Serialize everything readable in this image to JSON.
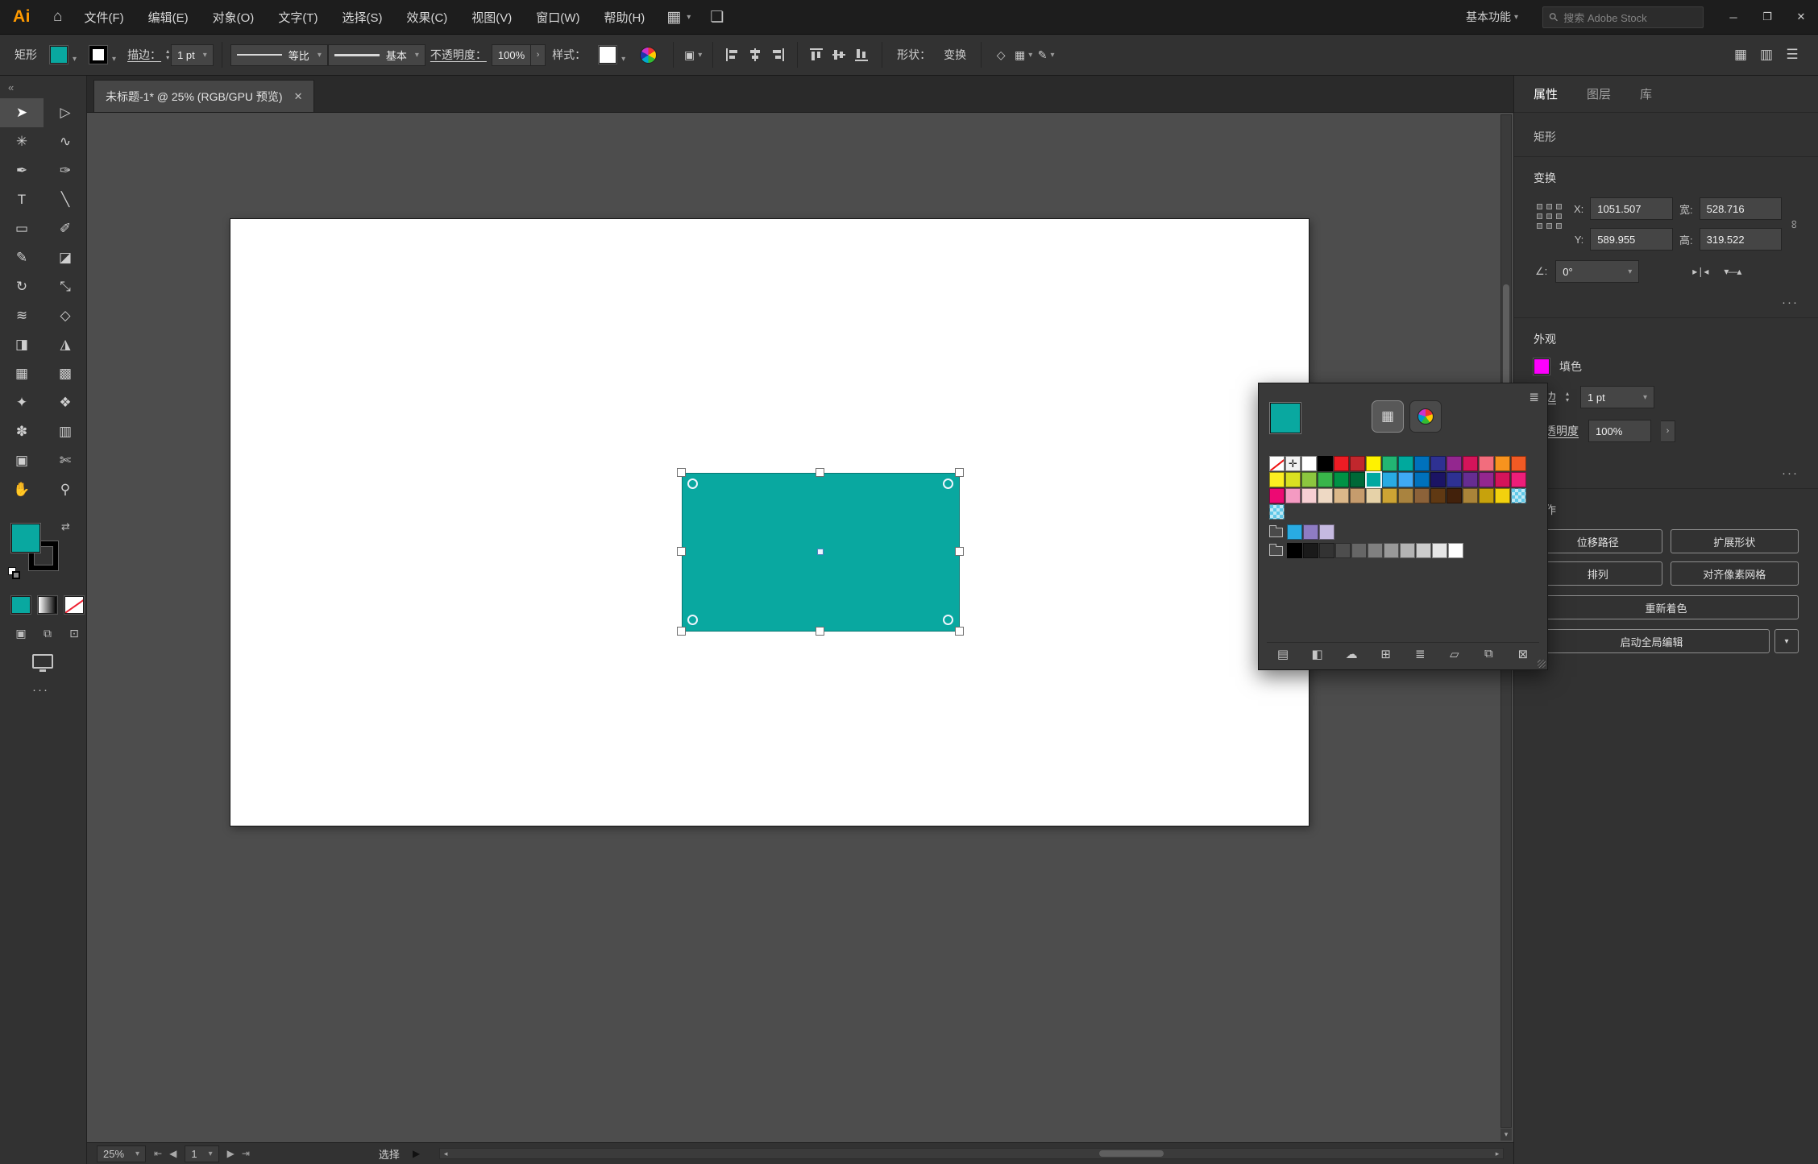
{
  "app": {
    "logo": "Ai"
  },
  "menubar": {
    "items": [
      "文件(F)",
      "编辑(E)",
      "对象(O)",
      "文字(T)",
      "选择(S)",
      "效果(C)",
      "视图(V)",
      "窗口(W)",
      "帮助(H)"
    ],
    "workspace": "基本功能",
    "search_placeholder": "搜索 Adobe Stock"
  },
  "controlbar": {
    "context_label": "矩形",
    "fill_color": "#09a8a0",
    "stroke_label": "描边：",
    "stroke_weight": "1 pt",
    "width_profile": "等比",
    "brush_definition": "基本",
    "opacity_label": "不透明度：",
    "opacity_value": "100%",
    "style_label": "样式：",
    "shape_label": "形状：",
    "transform_label": "变换"
  },
  "tab": {
    "title": "未标题-1* @ 25% (RGB/GPU 预览)"
  },
  "toolbar": {
    "fill_color": "#09a8a0",
    "stroke_color": "#000000",
    "tools": [
      {
        "name": "selection-tool",
        "glyph": "➤",
        "active": true
      },
      {
        "name": "direct-selection-tool",
        "glyph": "▷"
      },
      {
        "name": "magic-wand-tool",
        "glyph": "✳"
      },
      {
        "name": "lasso-tool",
        "glyph": "∿"
      },
      {
        "name": "pen-tool",
        "glyph": "✒"
      },
      {
        "name": "curvature-tool",
        "glyph": "✑"
      },
      {
        "name": "type-tool",
        "glyph": "T"
      },
      {
        "name": "line-segment-tool",
        "glyph": "╲"
      },
      {
        "name": "rectangle-tool",
        "glyph": "▭"
      },
      {
        "name": "paintbrush-tool",
        "glyph": "✐"
      },
      {
        "name": "shaper-tool",
        "glyph": "✎"
      },
      {
        "name": "eraser-tool",
        "glyph": "◪"
      },
      {
        "name": "rotate-tool",
        "glyph": "↻"
      },
      {
        "name": "scale-tool",
        "glyph": "⤡"
      },
      {
        "name": "width-tool",
        "glyph": "≋"
      },
      {
        "name": "free-transform-tool",
        "glyph": "◇"
      },
      {
        "name": "shape-builder-tool",
        "glyph": "◨"
      },
      {
        "name": "perspective-grid-tool",
        "glyph": "◮"
      },
      {
        "name": "mesh-tool",
        "glyph": "▦"
      },
      {
        "name": "gradient-tool",
        "glyph": "▩"
      },
      {
        "name": "eyedropper-tool",
        "glyph": "✦"
      },
      {
        "name": "blend-tool",
        "glyph": "❖"
      },
      {
        "name": "symbol-sprayer-tool",
        "glyph": "✽"
      },
      {
        "name": "column-graph-tool",
        "glyph": "▥"
      },
      {
        "name": "artboard-tool",
        "glyph": "▣"
      },
      {
        "name": "slice-tool",
        "glyph": "✄"
      },
      {
        "name": "hand-tool",
        "glyph": "✋"
      },
      {
        "name": "zoom-tool",
        "glyph": "⚲"
      }
    ]
  },
  "swatches_popup": {
    "current_color": "#09a8a0",
    "grid_rows": [
      [
        "none",
        "registration",
        "#ffffff",
        "#000000",
        "#ed1c24",
        "#c1272d",
        "#fff200",
        "#22b573",
        "#00a99d",
        "#0071bc",
        "#2e3192",
        "#93278f",
        "#d4145a",
        "#f26d7d",
        "#f7931e",
        "#f15a24"
      ],
      [
        "#fcee21",
        "#d9e021",
        "#8cc63f",
        "#39b54a",
        "#009245",
        "#006837",
        "#00a8a0",
        "#29abe2",
        "#3fa9f5",
        "#0071bc",
        "#1b1464",
        "#2e3192",
        "#662d91",
        "#93278f",
        "#d4145a",
        "#ed1e79"
      ],
      [
        "#ed0973",
        "#f49ac2",
        "#f7cfd3",
        "#eed9c4",
        "#dbb88a",
        "#c69c6d",
        "#e6d2a8",
        "#cda434",
        "#a9833f",
        "#8c6239",
        "#603913",
        "#42210b",
        "#aa8439",
        "#c7a20c",
        "#f2d10e",
        "pattern"
      ],
      [
        "pattern"
      ]
    ],
    "selected": {
      "row": 1,
      "index": 6
    },
    "groups": [
      {
        "colors": [
          "#29abe2",
          "#8e7cc3",
          "#c5b9e0"
        ]
      },
      {
        "colors": [
          "#000000",
          "#1a1a1a",
          "#333333",
          "#4d4d4d",
          "#666666",
          "#808080",
          "#999999",
          "#b3b3b3",
          "#cccccc",
          "#e6e6e6",
          "#ffffff"
        ]
      }
    ],
    "footer_icons": [
      {
        "name": "swatch-libraries-menu-icon",
        "glyph": "▤"
      },
      {
        "name": "show-swatch-kinds-icon",
        "glyph": "◧"
      },
      {
        "name": "cloud-sync-icon",
        "glyph": "☁"
      },
      {
        "name": "new-color-group-icon",
        "glyph": "⊞"
      },
      {
        "name": "swatch-options-icon",
        "glyph": "≣"
      },
      {
        "name": "new-folder-icon",
        "glyph": "▱"
      },
      {
        "name": "new-swatch-icon",
        "glyph": "⧉"
      },
      {
        "name": "delete-swatch-icon",
        "glyph": "⊠"
      }
    ]
  },
  "properties": {
    "tabs": [
      "属性",
      "图层",
      "库"
    ],
    "object_type": "矩形",
    "transform": {
      "label": "变换",
      "x_label": "X:",
      "x_value": "1051.507",
      "y_label": "Y:",
      "y_value": "589.955",
      "w_label": "宽:",
      "w_value": "528.716",
      "h_label": "高:",
      "h_value": "319.522",
      "angle_label": "∠:",
      "angle_value": "0°"
    },
    "appearance": {
      "label": "外观",
      "fill_label": "填色",
      "fill_color": "#ff00ff",
      "stroke_label": "描边",
      "stroke_value": "1 pt",
      "opacity_label": "不透明度",
      "opacity_value": "100%"
    },
    "actions": {
      "label": "操作",
      "buttons": [
        "位移路径",
        "扩展形状",
        "排列",
        "对齐像素网格"
      ],
      "recolor": "重新着色",
      "global_edit": "启动全局编辑"
    },
    "more": "⋯"
  },
  "statusbar": {
    "zoom": "25%",
    "artboard": "1",
    "status": "选择"
  },
  "icons": {
    "home": "⌂",
    "arrange_docs": "▦",
    "share": "❏",
    "chevron": "▾",
    "chevron_up": "▴",
    "search": "⚲",
    "minimize": "─",
    "restore": "❐",
    "close": "✕",
    "collapse_left": "«",
    "more_h": "···",
    "swap": "⇄",
    "panel_grid": "▦",
    "panel_columns": "▥",
    "panel_menu": "☰",
    "arrow_right_btn": "›",
    "flip_h": "▸❘◂",
    "flip_v": "▾—▴",
    "link": "∞",
    "menu_lines": "≣",
    "first": "⇤",
    "prev": "◀",
    "next": "▶",
    "last": "⇥",
    "play": "▶",
    "scroll_left": "◂",
    "scroll_right": "▸",
    "scroll_down": "▾",
    "dm_normal": "▣",
    "dm_behind": "⧉",
    "dm_inside": "⊡",
    "transform_widget": "◇",
    "pathfinder": "▦",
    "edit_appearance": "✎"
  }
}
